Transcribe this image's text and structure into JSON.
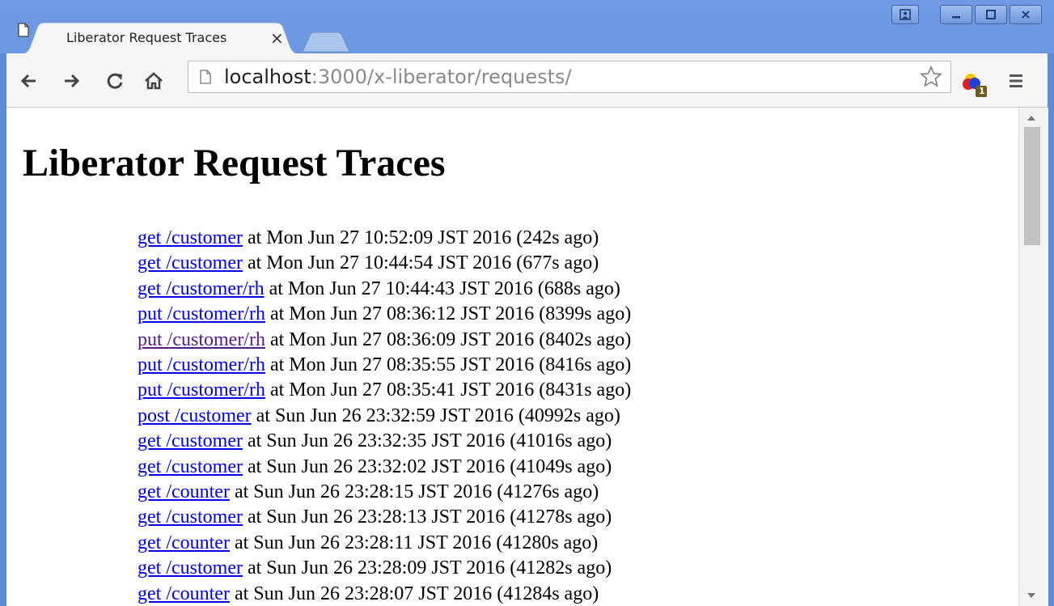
{
  "tab": {
    "title": "Liberator Request Traces",
    "close": "×"
  },
  "omnibox": {
    "host": "localhost",
    "rest": ":3000/x-liberator/requests/"
  },
  "icons": {
    "page": "page-icon",
    "back": "back-arrow-icon",
    "forward": "forward-arrow-icon",
    "reload": "reload-icon",
    "home": "home-icon",
    "star": "star-icon",
    "extension": "extension-icon",
    "menu": "menu-icon",
    "user": "user-icon",
    "minimize": "minimize-icon",
    "maximize": "maximize-icon",
    "close": "close-icon"
  },
  "extension_badge": "1",
  "page": {
    "title": "Liberator Request Traces",
    "requests": [
      {
        "link": "get /customer",
        "detail": " at Mon Jun 27 10:52:09 JST 2016 (242s ago)",
        "visited": false
      },
      {
        "link": "get /customer",
        "detail": " at Mon Jun 27 10:44:54 JST 2016 (677s ago)",
        "visited": false
      },
      {
        "link": "get /customer/rh",
        "detail": " at Mon Jun 27 10:44:43 JST 2016 (688s ago)",
        "visited": false
      },
      {
        "link": "put /customer/rh",
        "detail": " at Mon Jun 27 08:36:12 JST 2016 (8399s ago)",
        "visited": false
      },
      {
        "link": "put /customer/rh",
        "detail": " at Mon Jun 27 08:36:09 JST 2016 (8402s ago)",
        "visited": true
      },
      {
        "link": "put /customer/rh",
        "detail": " at Mon Jun 27 08:35:55 JST 2016 (8416s ago)",
        "visited": false
      },
      {
        "link": "put /customer/rh",
        "detail": " at Mon Jun 27 08:35:41 JST 2016 (8431s ago)",
        "visited": false
      },
      {
        "link": "post /customer",
        "detail": " at Sun Jun 26 23:32:59 JST 2016 (40992s ago)",
        "visited": false
      },
      {
        "link": "get /customer",
        "detail": " at Sun Jun 26 23:32:35 JST 2016 (41016s ago)",
        "visited": false
      },
      {
        "link": "get /customer",
        "detail": " at Sun Jun 26 23:32:02 JST 2016 (41049s ago)",
        "visited": false
      },
      {
        "link": "get /counter",
        "detail": " at Sun Jun 26 23:28:15 JST 2016 (41276s ago)",
        "visited": false
      },
      {
        "link": "get /customer",
        "detail": " at Sun Jun 26 23:28:13 JST 2016 (41278s ago)",
        "visited": false
      },
      {
        "link": "get /counter",
        "detail": " at Sun Jun 26 23:28:11 JST 2016 (41280s ago)",
        "visited": false
      },
      {
        "link": "get /customer",
        "detail": " at Sun Jun 26 23:28:09 JST 2016 (41282s ago)",
        "visited": false
      },
      {
        "link": "get /counter",
        "detail": " at Sun Jun 26 23:28:07 JST 2016 (41284s ago)",
        "visited": false
      }
    ]
  },
  "colors": {
    "link": "#0000ee",
    "visited_link": "#551a8b",
    "frame": "#5a8bd8"
  }
}
